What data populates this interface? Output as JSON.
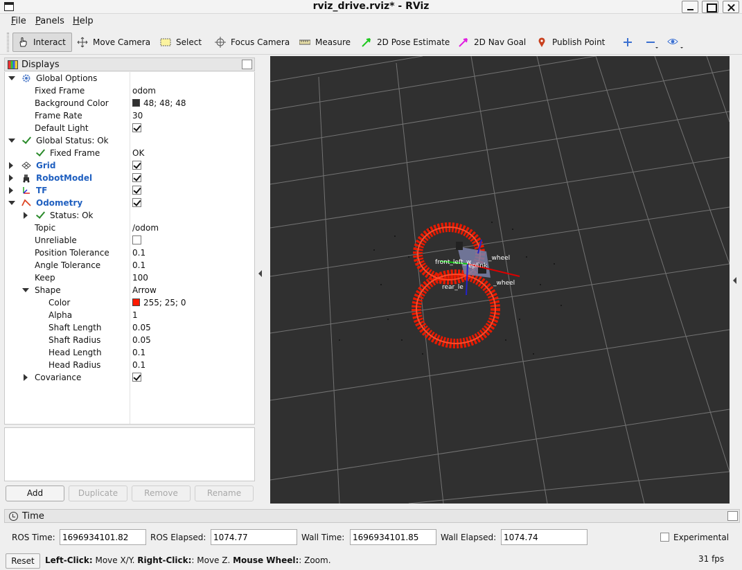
{
  "window": {
    "title": "rviz_drive.rviz* - RViz"
  },
  "menu": [
    {
      "label": "File",
      "mnemonic": "F",
      "rest": "ile"
    },
    {
      "label": "Panels",
      "mnemonic": "P",
      "rest": "anels"
    },
    {
      "label": "Help",
      "mnemonic": "H",
      "rest": "elp"
    }
  ],
  "toolbar": {
    "interact": "Interact",
    "move_camera": "Move Camera",
    "select": "Select",
    "focus_camera": "Focus Camera",
    "measure": "Measure",
    "pose_estimate": "2D Pose Estimate",
    "nav_goal": "2D Nav Goal",
    "publish_point": "Publish Point"
  },
  "displays": {
    "title": "Displays",
    "global_options": "Global Options",
    "fixed_frame_label": "Fixed Frame",
    "fixed_frame_value": "odom",
    "background_color_label": "Background Color",
    "background_color_value": "48; 48; 48",
    "background_color_hex": "#303030",
    "frame_rate_label": "Frame Rate",
    "frame_rate_value": "30",
    "default_light_label": "Default Light",
    "global_status": "Global Status: Ok",
    "status_fixed_frame_label": "Fixed Frame",
    "status_fixed_frame_value": "OK",
    "grid": "Grid",
    "robot_model": "RobotModel",
    "tf": "TF",
    "odometry": "Odometry",
    "odom_status": "Status: Ok",
    "topic_label": "Topic",
    "topic_value": "/odom",
    "unreliable_label": "Unreliable",
    "position_tolerance_label": "Position Tolerance",
    "position_tolerance_value": "0.1",
    "angle_tolerance_label": "Angle Tolerance",
    "angle_tolerance_value": "0.1",
    "keep_label": "Keep",
    "keep_value": "100",
    "shape_label": "Shape",
    "shape_value": "Arrow",
    "color_label": "Color",
    "color_value": "255; 25; 0",
    "color_hex": "#ff1900",
    "alpha_label": "Alpha",
    "alpha_value": "1",
    "shaft_length_label": "Shaft Length",
    "shaft_length_value": "0.05",
    "shaft_radius_label": "Shaft Radius",
    "shaft_radius_value": "0.05",
    "head_length_label": "Head Length",
    "head_length_value": "0.1",
    "head_radius_label": "Head Radius",
    "head_radius_value": "0.1",
    "covariance_label": "Covariance"
  },
  "panel_buttons": {
    "add": "Add",
    "duplicate": "Duplicate",
    "remove": "Remove",
    "rename": "Rename"
  },
  "scene_labels": {
    "front": "front_left_w",
    "rear": "rear_le",
    "wheel1": "_wheel",
    "wheel2": "_wheel",
    "base": "eplink"
  },
  "time": {
    "title": "Time",
    "ros_time_label": "ROS Time:",
    "ros_time_value": "1696934101.82",
    "ros_elapsed_label": "ROS Elapsed:",
    "ros_elapsed_value": "1074.77",
    "wall_time_label": "Wall Time:",
    "wall_time_value": "1696934101.85",
    "wall_elapsed_label": "Wall Elapsed:",
    "wall_elapsed_value": "1074.74",
    "experimental_label": "Experimental"
  },
  "status": {
    "reset": "Reset",
    "hint_b1": "Left-Click:",
    "hint_t1": " Move X/Y. ",
    "hint_b2": "Right-Click:",
    "hint_t2": ": Move Z. ",
    "hint_b3": "Mouse Wheel:",
    "hint_t3": ": Zoom.",
    "fps": "31 fps"
  }
}
